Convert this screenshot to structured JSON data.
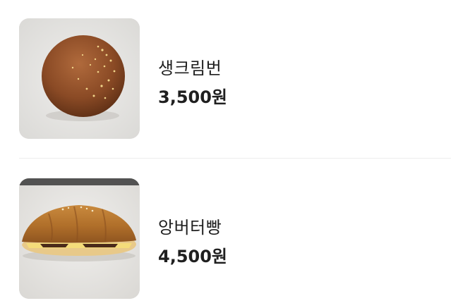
{
  "menu": {
    "items": [
      {
        "image_icon": "cream-bun-photo",
        "name": "생크림번",
        "price": "3,500원"
      },
      {
        "image_icon": "salt-butter-bread-photo",
        "name": "앙버터빵",
        "price": "4,500원"
      }
    ]
  }
}
